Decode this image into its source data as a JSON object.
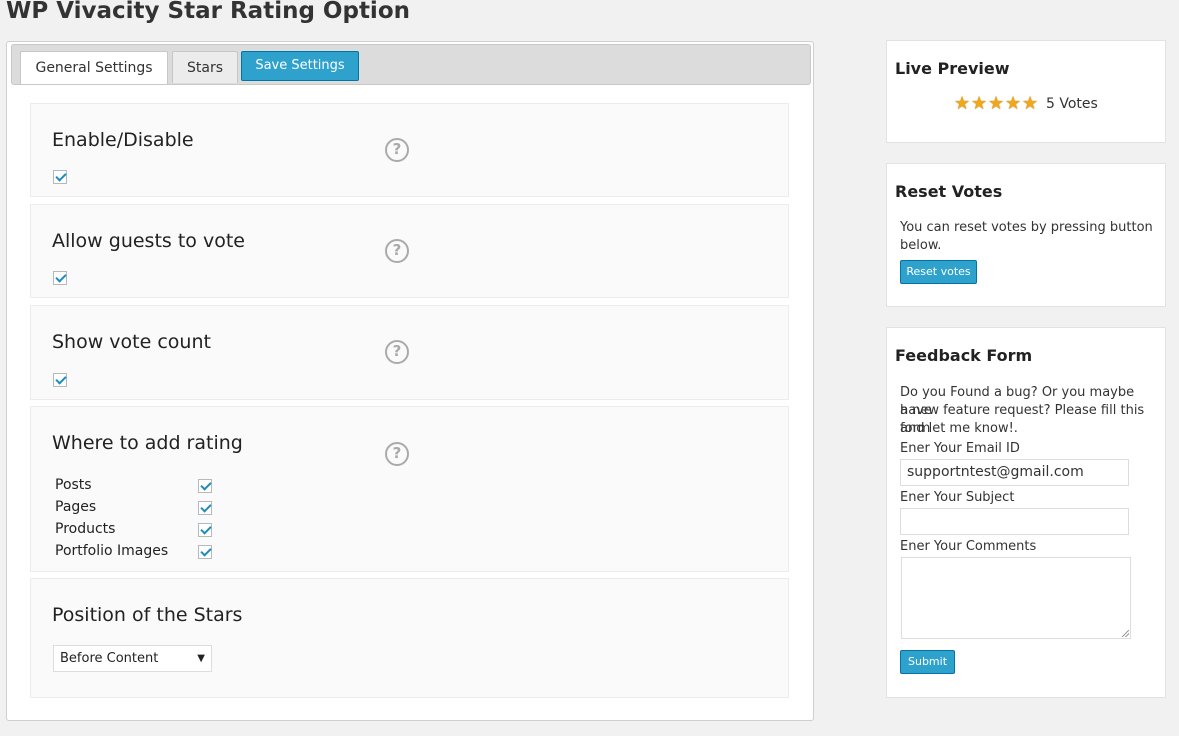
{
  "page": {
    "title": "WP Vivacity Star Rating Option"
  },
  "tabs": [
    {
      "label": "General Settings",
      "active": true
    },
    {
      "label": "Stars",
      "active": false
    }
  ],
  "save_button": "Save Settings",
  "sections": {
    "enable": {
      "title": "Enable/Disable",
      "checked": true
    },
    "guests": {
      "title": "Allow guests to vote",
      "checked": true
    },
    "vote_count": {
      "title": "Show vote count",
      "checked": true
    },
    "where": {
      "title": "Where to add rating",
      "options": [
        {
          "label": "Posts",
          "checked": true
        },
        {
          "label": "Pages",
          "checked": true
        },
        {
          "label": "Products",
          "checked": true
        },
        {
          "label": "Portfolio Images",
          "checked": true
        }
      ]
    },
    "position": {
      "title": "Position of the Stars",
      "selected": "Before Content"
    }
  },
  "help_icon_glyph": "?",
  "sidebar": {
    "live_preview": {
      "title": "Live Preview",
      "rating": 5,
      "max_rating": 5,
      "star_glyph": "★",
      "votes_text": "5 Votes"
    },
    "reset_votes": {
      "title": "Reset Votes",
      "text_line1": "You can reset votes by pressing button",
      "text_line2": "below.",
      "button": "Reset votes"
    },
    "feedback": {
      "title": "Feedback Form",
      "text_line1": "Do you Found a bug? Or you maybe have",
      "text_line2": "a new feature request? Please fill this form",
      "text_line3": "and let me know!.",
      "email_label": "Ener Your Email ID",
      "email_value": "supportntest@gmail.com",
      "subject_label": "Ener Your Subject",
      "subject_value": "",
      "comments_label": "Ener Your Comments",
      "submit": "Submit"
    }
  },
  "colors": {
    "accent": "#2ea2cc",
    "accent_border": "#0074a2",
    "checkmark": "#1e8cbe",
    "star": "#f0a818"
  }
}
